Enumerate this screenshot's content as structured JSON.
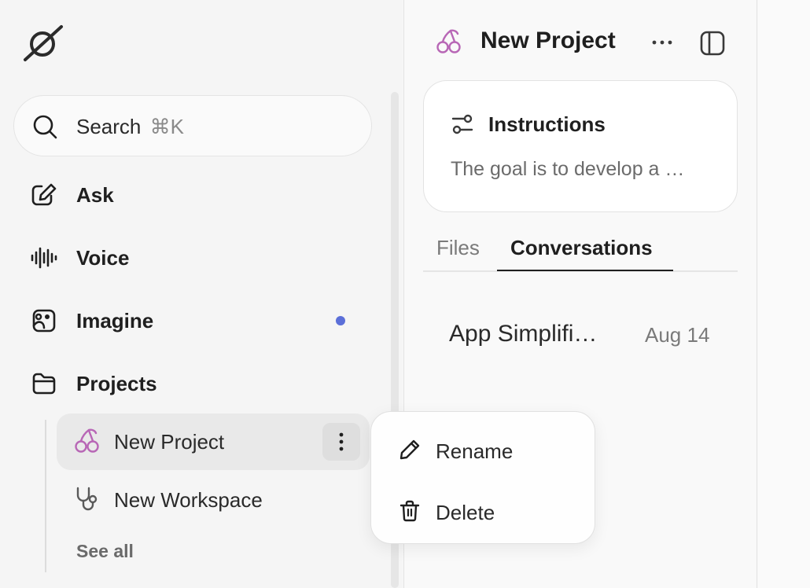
{
  "sidebar": {
    "search": {
      "label": "Search",
      "shortcut": "⌘K"
    },
    "nav": [
      {
        "label": "Ask",
        "icon": "pencil-square-icon"
      },
      {
        "label": "Voice",
        "icon": "waveform-icon"
      },
      {
        "label": "Imagine",
        "icon": "image-sparkle-icon",
        "has_badge_dot": true
      },
      {
        "label": "Projects",
        "icon": "folder-icon"
      }
    ],
    "projects": [
      {
        "label": "New Project",
        "icon": "cherry-icon",
        "active": true
      },
      {
        "label": "New Workspace",
        "icon": "stethoscope-icon"
      }
    ],
    "see_all": "See all"
  },
  "panel": {
    "title": "New Project",
    "instructions": {
      "title": "Instructions",
      "description": "The goal is to develop a …"
    },
    "tabs": [
      {
        "label": "Files",
        "active": false
      },
      {
        "label": "Conversations",
        "active": true
      }
    ],
    "conversations": [
      {
        "name": "App Simplifi…",
        "date": "Aug 14"
      }
    ]
  },
  "context_menu": {
    "items": [
      {
        "label": "Rename",
        "icon": "pencil-icon"
      },
      {
        "label": "Delete",
        "icon": "trash-icon"
      }
    ]
  },
  "colors": {
    "accent_dot": "#5b6fd8",
    "cherry": "#b867b6"
  }
}
